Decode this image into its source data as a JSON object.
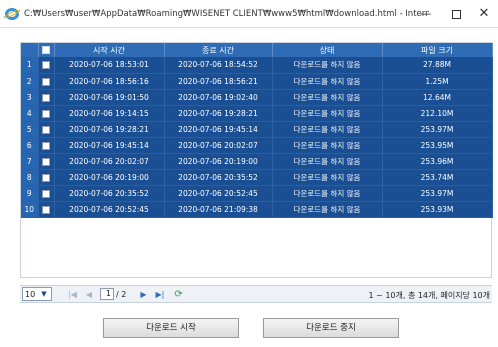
{
  "window": {
    "title": "C:₩Users₩user₩AppData₩Roaming₩WISENET CLIENT₩www5₩html₩download.html - Internet Exp...",
    "minimize": "—",
    "close": "✕"
  },
  "table": {
    "headers": [
      "",
      "",
      "시작 시간",
      "종료 시간",
      "상태",
      "파일 크기"
    ],
    "rows": [
      {
        "n": "1",
        "start": "2020-07-06 18:53:01",
        "end": "2020-07-06 18:54:52",
        "status": "다운로드를 하지 않음",
        "size": "27.88M"
      },
      {
        "n": "2",
        "start": "2020-07-06 18:56:16",
        "end": "2020-07-06 18:56:21",
        "status": "다운로드를 하지 않음",
        "size": "1.25M"
      },
      {
        "n": "3",
        "start": "2020-07-06 19:01:50",
        "end": "2020-07-06 19:02:40",
        "status": "다운로드를 하지 않음",
        "size": "12.64M"
      },
      {
        "n": "4",
        "start": "2020-07-06 19:14:15",
        "end": "2020-07-06 19:28:21",
        "status": "다운로드를 하지 않음",
        "size": "212.10M"
      },
      {
        "n": "5",
        "start": "2020-07-06 19:28:21",
        "end": "2020-07-06 19:45:14",
        "status": "다운로드를 하지 않음",
        "size": "253.97M"
      },
      {
        "n": "6",
        "start": "2020-07-06 19:45:14",
        "end": "2020-07-06 20:02:07",
        "status": "다운로드를 하지 않음",
        "size": "253.95M"
      },
      {
        "n": "7",
        "start": "2020-07-06 20:02:07",
        "end": "2020-07-06 20:19:00",
        "status": "다운로드를 하지 않음",
        "size": "253.96M"
      },
      {
        "n": "8",
        "start": "2020-07-06 20:19:00",
        "end": "2020-07-06 20:35:52",
        "status": "다운로드를 하지 않음",
        "size": "253.74M"
      },
      {
        "n": "9",
        "start": "2020-07-06 20:35:52",
        "end": "2020-07-06 20:52:45",
        "status": "다운로드를 하지 않음",
        "size": "253.97M"
      },
      {
        "n": "10",
        "start": "2020-07-06 20:52:45",
        "end": "2020-07-06 21:09:38",
        "status": "다운로드를 하지 않음",
        "size": "253.93M"
      }
    ]
  },
  "pager": {
    "page_size": "10",
    "current_page": "1",
    "total_pages": "/ 2",
    "info": "1 ~ 10개, 총 14개, 페이지당 10개",
    "first_icon": "first-page-icon",
    "prev_icon": "prev-page-icon",
    "next_icon": "next-page-icon",
    "last_icon": "last-page-icon",
    "refresh_icon": "refresh-icon"
  },
  "buttons": {
    "start": "다운로드 시작",
    "stop": "다운로드 중지"
  },
  "colors": {
    "header_blue": "#2f6cb5",
    "row_blue": "#1b4f93"
  }
}
